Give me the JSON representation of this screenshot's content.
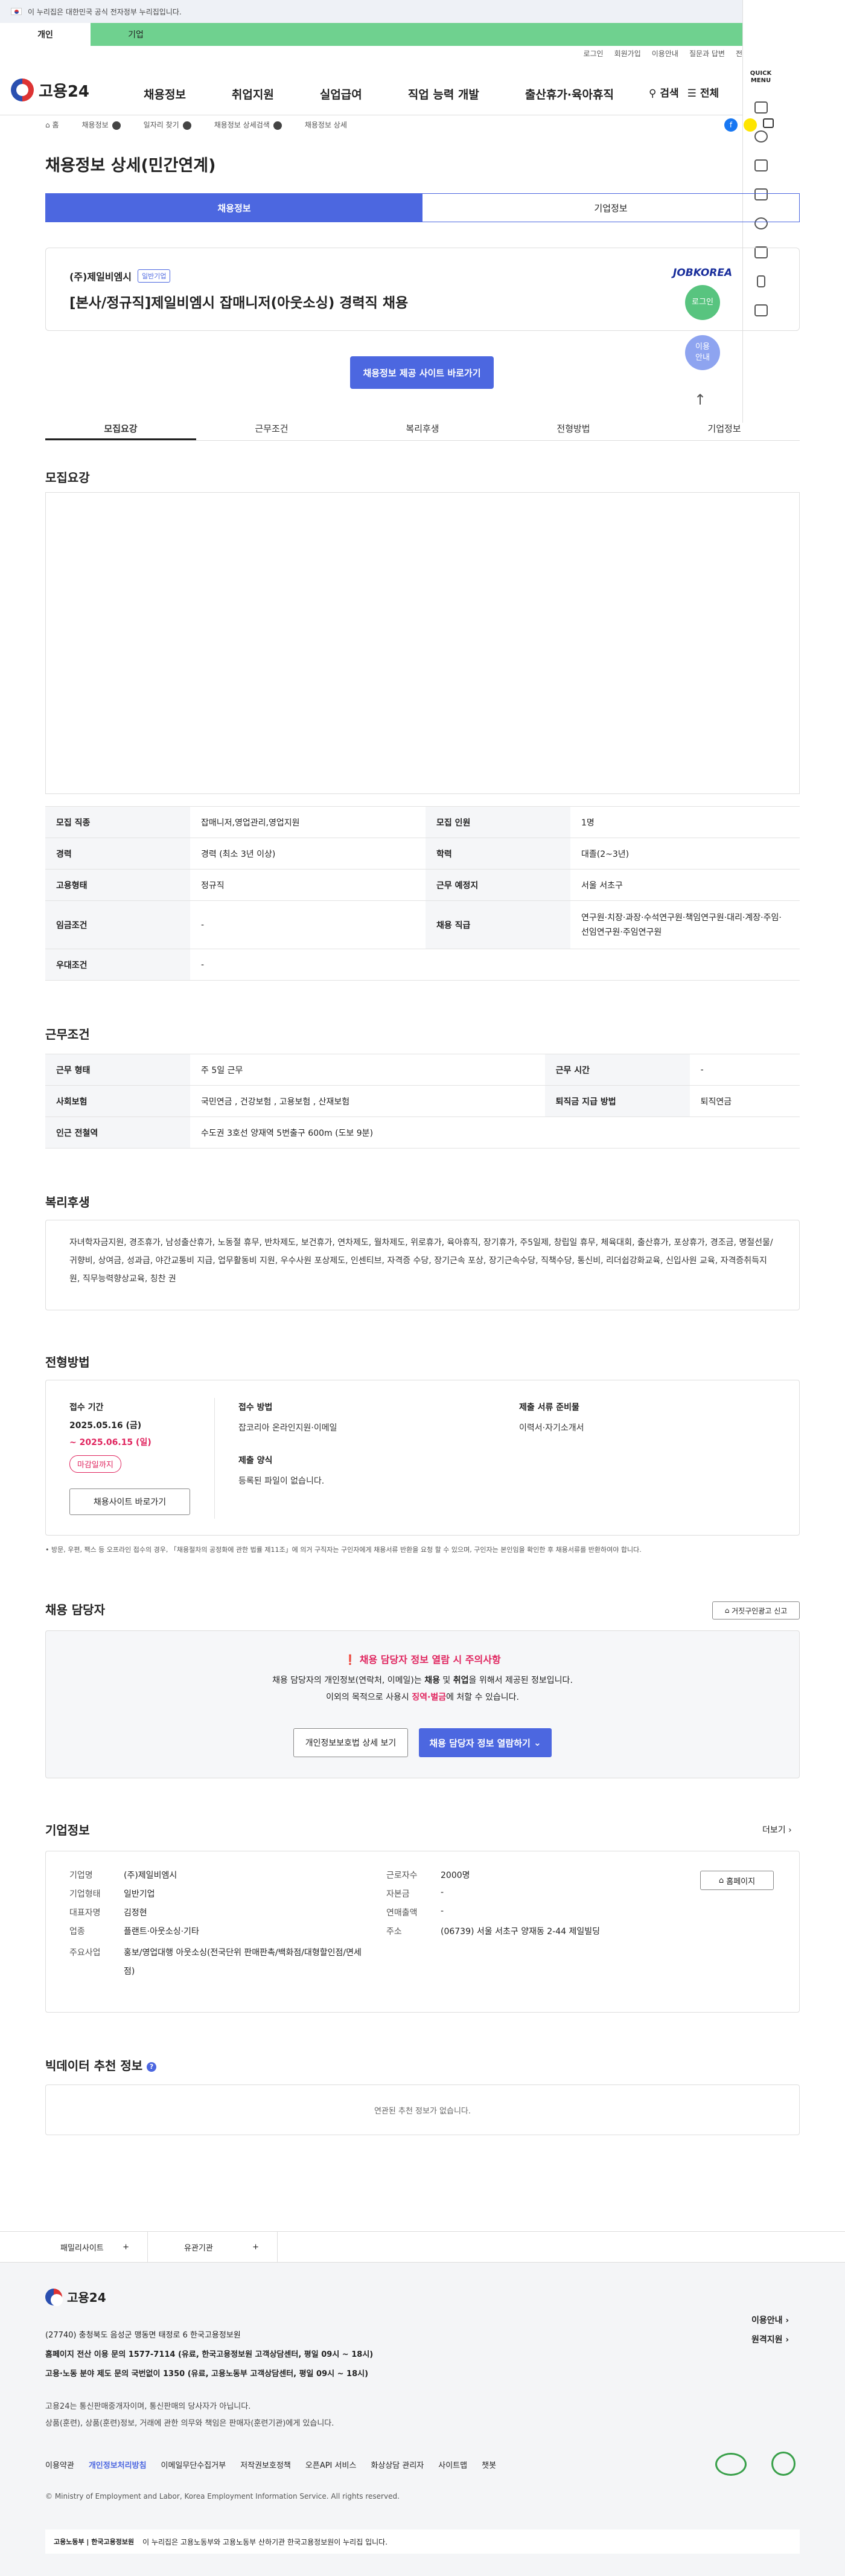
{
  "gov_bar": {
    "text": "이 누리집은 대한민국 공식 전자정부 누리집입니다."
  },
  "user_tabs": [
    "개인",
    "기업"
  ],
  "util_links": [
    "로그인",
    "회원가입",
    "이용안내",
    "질문과 답변",
    "전"
  ],
  "logo": {
    "text": "고용24"
  },
  "gnb": [
    "채용정보",
    "취업지원",
    "실업급여",
    "직업 능력 개발",
    "출산휴가·육아휴직"
  ],
  "search_label": "검색",
  "menu_label": "전체",
  "quick": {
    "title": "QUICK MENU",
    "login": "로그인",
    "guide": "이용 안내"
  },
  "breadcrumb": [
    "홈",
    "채용정보",
    "일자리 찾기",
    "채용정보 상세검색",
    "채용정보 상세"
  ],
  "page_title": "채용정보 상세(민간연계)",
  "seg_tabs": [
    "채용정보",
    "기업정보"
  ],
  "job": {
    "company": "(주)제일비엠시",
    "badge": "일반기업",
    "title": "[본사/정규직]제일비엠시 잡매니저(아웃소싱) 경력직 채용",
    "source": "JOBKOREA"
  },
  "apply_btn": "채용정보 제공 사이트 바로가기",
  "subnav": [
    "모집요강",
    "근무조건",
    "복리후생",
    "전형방법",
    "기업정보"
  ],
  "sec_recruit": "모집요강",
  "recruit_rows": [
    [
      "모집 직종",
      "잡매니저,영업관리,영업지원",
      "모집 인원",
      "1명"
    ],
    [
      "경력",
      "경력 (최소 3년 이상)",
      "학력",
      "대졸(2~3년)"
    ],
    [
      "고용형태",
      "정규직",
      "근무 예정지",
      "서울 서초구"
    ],
    [
      "임금조건",
      "-",
      "채용 직급",
      "연구원·치장·과장·수석연구원·책임연구원·대리·계장·주임·선임연구원·주임연구원"
    ],
    [
      "우대조건",
      "-"
    ]
  ],
  "sec_work": "근무조건",
  "work_rows": [
    [
      "근무 형태",
      "주 5일 근무",
      "근무 시간",
      "-"
    ],
    [
      "사회보험",
      "국민연금 , 건강보험 , 고용보험 , 산재보험",
      "퇴직금 지급 방법",
      "퇴직연금"
    ],
    [
      "인근 전철역",
      "수도권 3호선 양재역 5번출구 600m (도보 9분)"
    ]
  ],
  "sec_welfare": "복리후생",
  "welfare_text": "자녀학자금지원, 경조휴가, 남성출산휴가, 노동절 휴무, 반차제도, 보건휴가, 연차제도, 월차제도, 위로휴가, 육아휴직, 장기휴가, 주5일제, 창립일 휴무, 체육대회, 출산휴가, 포상휴가, 경조금, 명절선물/귀향비, 상여금, 성과급, 야간교통비 지급, 업무활동비 지원, 우수사원 포상제도, 인센티브, 자격증 수당, 장기근속 포상, 장기근속수당, 직책수당, 통신비, 리더쉽강화교육, 신입사원 교육, 자격증취득지원, 직무능력향상교육, 칭찬 권",
  "sec_process": "전형방법",
  "process": {
    "period_label": "접수 기간",
    "start": "2025.05.16 (금)",
    "end": "~ 2025.06.15 (일)",
    "status": "마감일까지",
    "site_btn": "채용사이트 바로가기",
    "method_label": "접수 방법",
    "method": "잡코리아 온라인지원·이메일",
    "docs_label": "제출 서류 준비물",
    "docs": "이력서·자기소개서",
    "form_label": "제출 양식",
    "form": "등록된 파일이 없습니다."
  },
  "process_note": "• 방문, 우편, 팩스 등 오프라인 접수의 경우, 「채용절차의 공정화에 관한 법률 제11조」에 의거 구직자는 구인자에게 채용서류 반환을 요청 할 수 있으며, 구인자는 본인임을 확인한 후 채용서류를 반환하여야 합니다.",
  "sec_contact": "채용 담당자",
  "report_btn": "거짓구인광고 신고",
  "contact": {
    "warn_title": "채용 담당자 정보 열람 시 주의사항",
    "warn1_a": "채용 담당자의 개인정보(연락처, 이메일)는 ",
    "warn1_b": "채용",
    "warn1_c": " 및 ",
    "warn1_d": "취업",
    "warn1_e": "을 위해서 제공된 정보입니다.",
    "warn2_a": "이외의 목적으로 사용시 ",
    "warn2_b": "징역·벌금",
    "warn2_c": "에 처할 수 있습니다.",
    "btn_privacy": "개인정보보호법 상세 보기",
    "btn_view": "채용 담당자 정보 열람하기"
  },
  "sec_company": "기업정보",
  "more": "더보기",
  "company_left": [
    [
      "기업명",
      "(주)제일비엠시"
    ],
    [
      "기업형태",
      "일반기업"
    ],
    [
      "대표자명",
      "김정현"
    ],
    [
      "업종",
      "플랜트·아웃소싱·기타"
    ],
    [
      "주요사업",
      "홍보/영업대행 아웃소싱(전국단위 판매판촉/백화점/대형할인점/면세점)"
    ]
  ],
  "company_right": [
    [
      "근로자수",
      "2000명"
    ],
    [
      "자본금",
      "-"
    ],
    [
      "연매출액",
      "-"
    ],
    [
      "주소",
      "(06739) 서울 서초구 양재동 2-44 제일빌딩"
    ]
  ],
  "homepage_btn": "홈페이지",
  "sec_bigdata": "빅데이터 추천 정보",
  "bigdata_empty": "연관된 추천 정보가 없습니다.",
  "footer_tabs": [
    "패밀리사이트",
    "유관기관"
  ],
  "footer": {
    "logo": "고용24",
    "addr": "(27740) 충청북도 음성군 맹동면 태정로 6 한국고용정보원",
    "line1": "홈페이지 전산 이용 문의 1577-7114 (유료, 한국고용정보원 고객상담센터, 평일 09시 ~ 18시)",
    "line2": "고용·노동 분야 제도 문의 국번없이 1350 (유료, 고용노동부 고객상담센터, 평일 09시 ~ 18시)",
    "note1": "고용24는 통신판매중개자이며, 통신판매의 당사자가 아닙니다.",
    "note2": "상품(훈련), 상품(훈련)정보, 거래에 관한 의무와 책임은 판매자(훈련기관)에게 있습니다.",
    "links": [
      "이용약관",
      "개인정보처리방침",
      "이메일무단수집거부",
      "저작권보호정책",
      "오픈API 서비스",
      "화상상담 관리자",
      "사이트맵",
      "챗봇"
    ],
    "right_links": [
      "이용안내",
      "원격지원"
    ],
    "copyright": "© Ministry of Employment and Labor, Korea Employment Information Service. All rights reserved.",
    "bottom": "이 누리집은 고용노동부와 고용노동부 산하기관 한국고용정보원이 누리집 입니다.",
    "bottom_logo": "고용노동부 | 한국고용정보원"
  },
  "colors": {
    "primary": "#4c67e0",
    "green": "#6fd18f",
    "red": "#e0245e"
  }
}
